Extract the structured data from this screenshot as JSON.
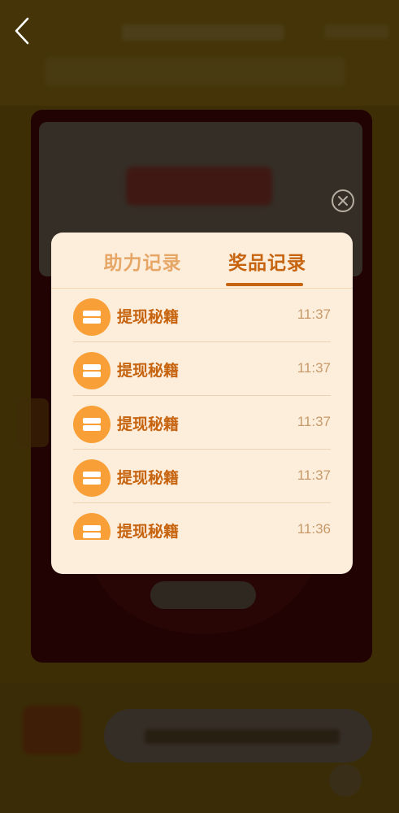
{
  "modal": {
    "tabs": [
      {
        "label": "助力记录",
        "active": false
      },
      {
        "label": "奖品记录",
        "active": true
      }
    ],
    "records": [
      {
        "icon": "coupon-icon",
        "name": "提现秘籍",
        "time": "11:37"
      },
      {
        "icon": "coupon-icon",
        "name": "提现秘籍",
        "time": "11:37"
      },
      {
        "icon": "coupon-icon",
        "name": "提现秘籍",
        "time": "11:37"
      },
      {
        "icon": "coupon-icon",
        "name": "提现秘籍",
        "time": "11:37"
      },
      {
        "icon": "coupon-icon",
        "name": "提现秘籍",
        "time": "11:36"
      }
    ]
  },
  "nav": {
    "back_icon": "chevron-left-icon",
    "close_icon": "close-circle-icon"
  },
  "colors": {
    "accent": "#c66410",
    "inactive_tab": "#e6a666",
    "icon_bg": "#f8a037",
    "modal_bg": "#fdeddb",
    "time_text": "#c69a6a"
  }
}
